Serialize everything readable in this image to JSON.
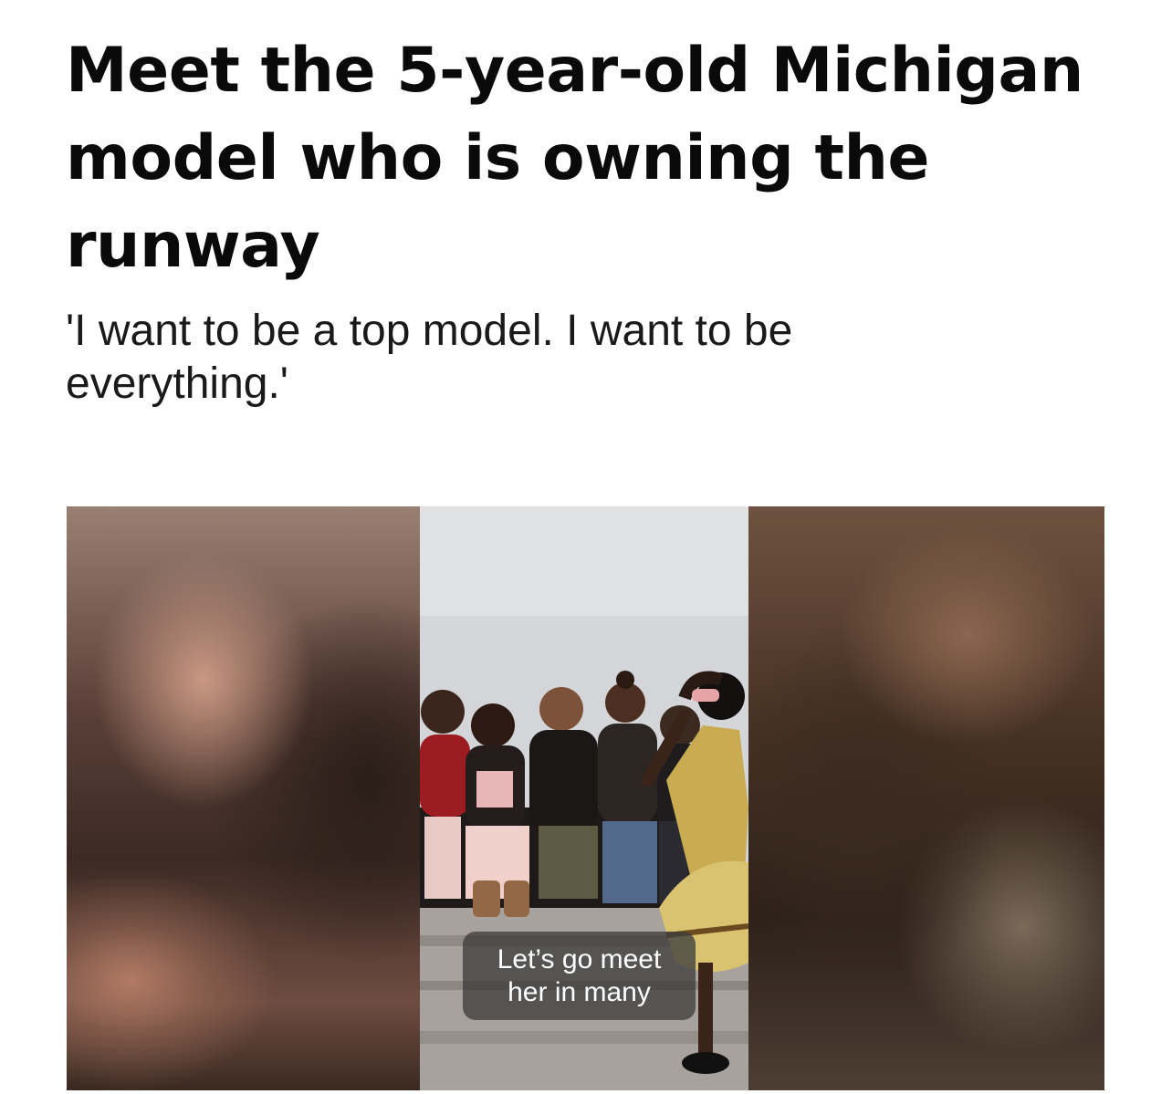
{
  "article": {
    "headline": "Meet the 5-year-old Michigan model who is owning the runway",
    "subhead": "'I want to be a top model. I want to be everything.'"
  },
  "video": {
    "caption": "Let’s go meet her in many"
  }
}
